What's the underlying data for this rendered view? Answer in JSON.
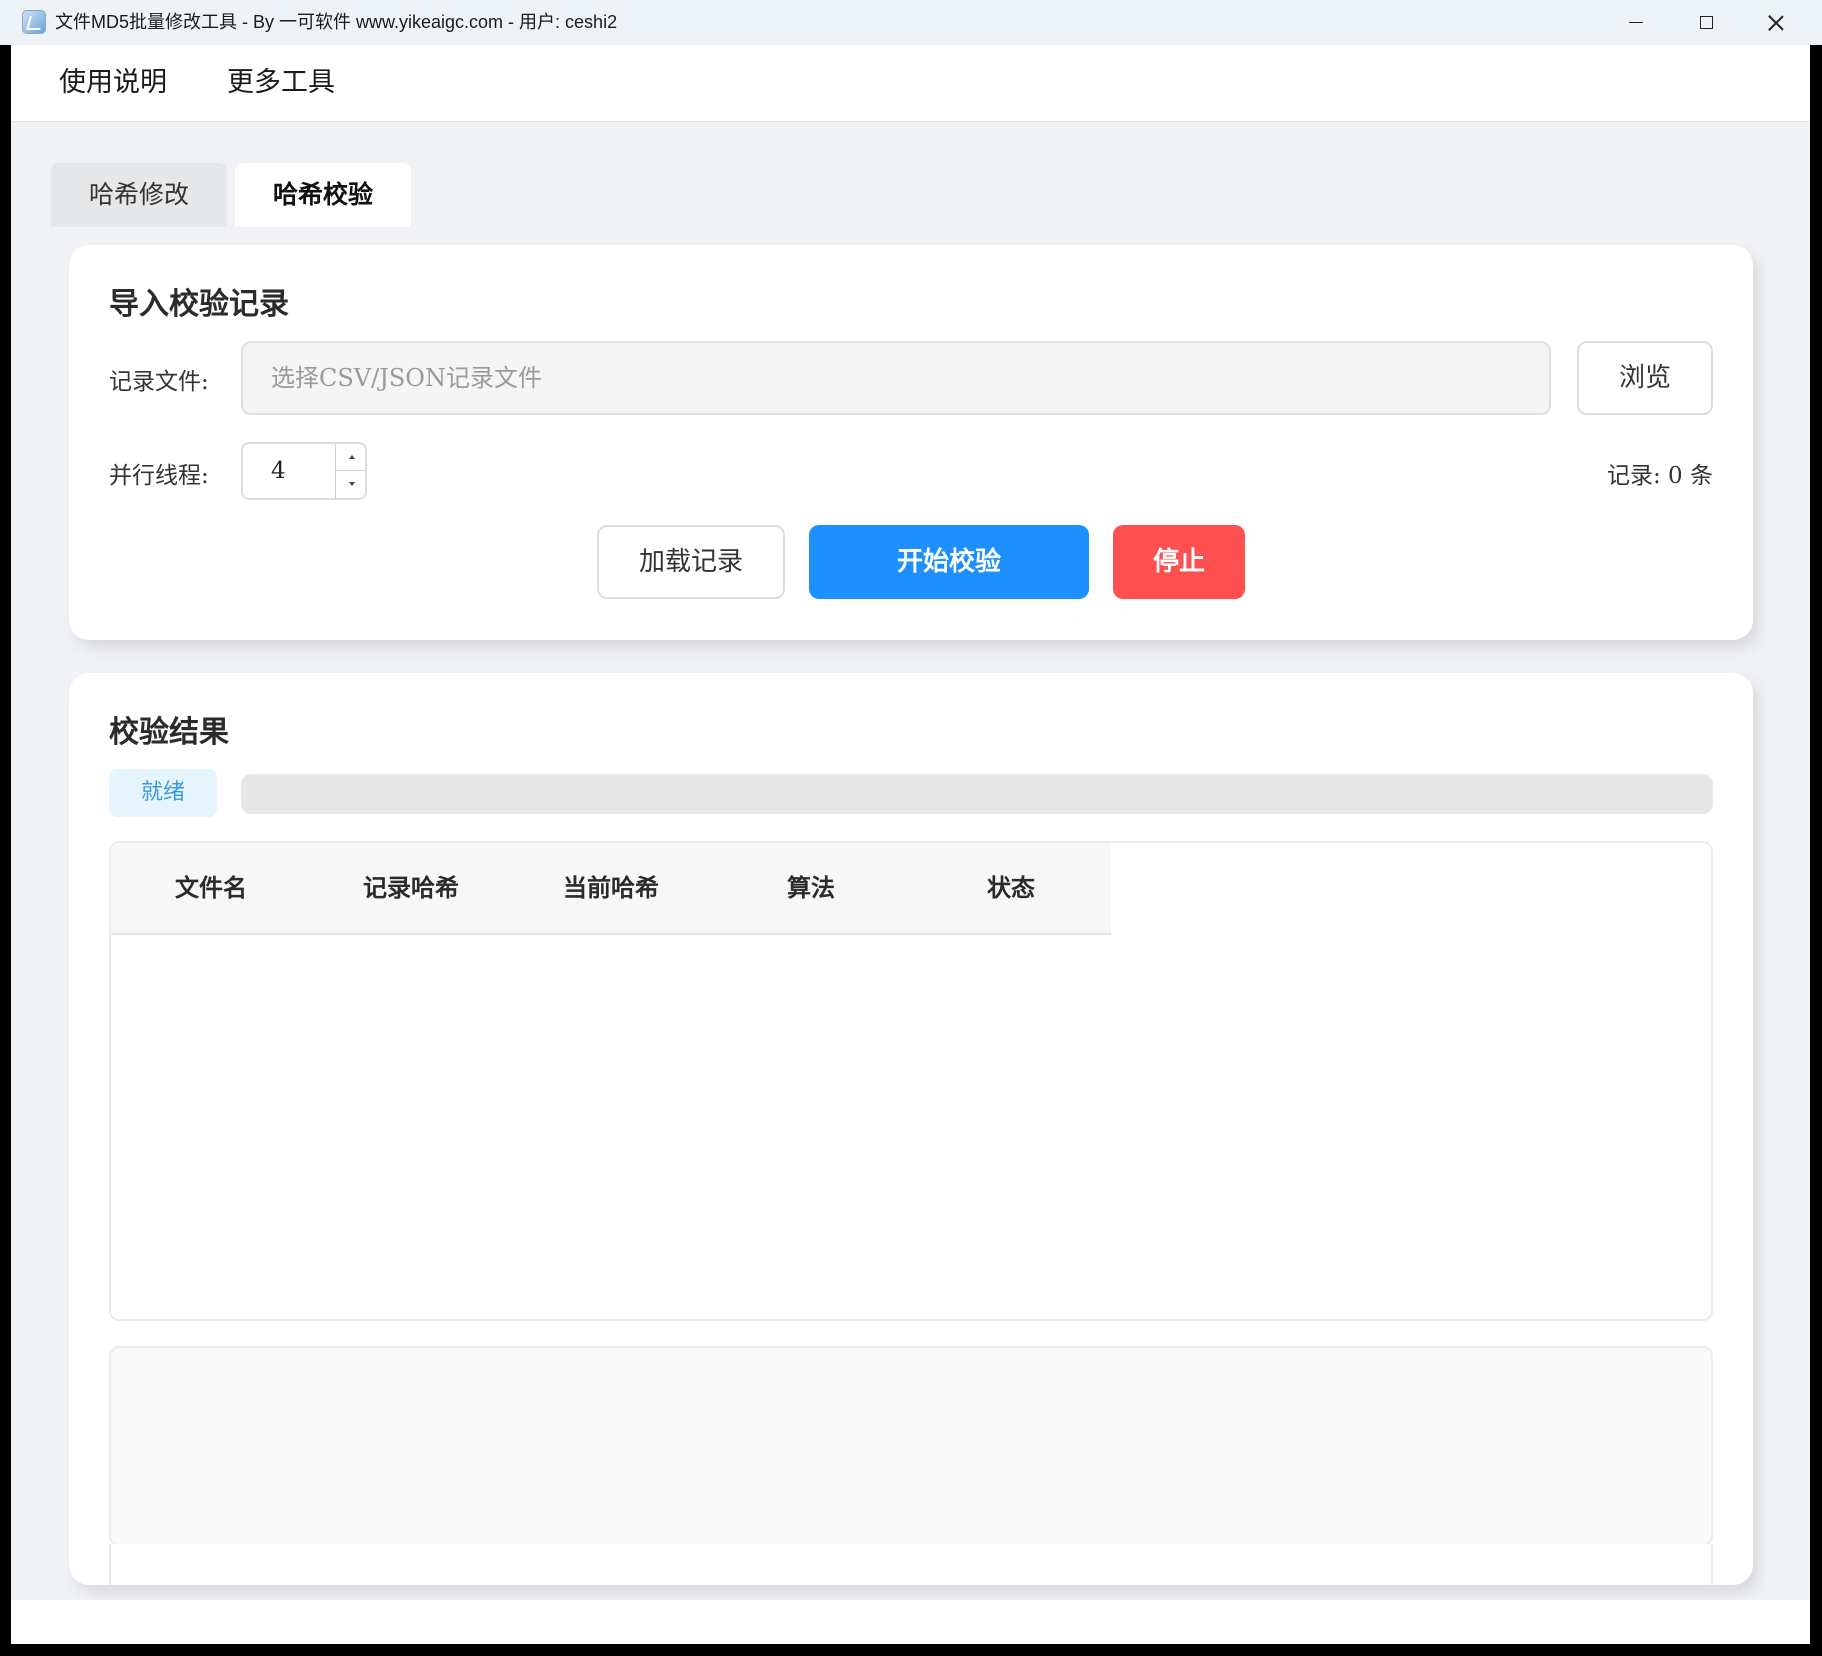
{
  "window": {
    "title": "文件MD5批量修改工具 - By 一可软件 www.yikeaigc.com - 用户: ceshi2",
    "app_icon": "app-icon"
  },
  "menubar": {
    "items": [
      "使用说明",
      "更多工具"
    ]
  },
  "tabs": [
    {
      "label": "哈希修改",
      "active": false
    },
    {
      "label": "哈希校验",
      "active": true
    }
  ],
  "import_section": {
    "title": "导入校验记录",
    "file_label": "记录文件:",
    "file_placeholder": "选择CSV/JSON记录文件",
    "file_value": "",
    "browse_label": "浏览",
    "threads_label": "并行线程:",
    "threads_value": "4",
    "record_count_text": "记录: 0 条",
    "load_label": "加载记录",
    "start_label": "开始校验",
    "stop_label": "停止"
  },
  "result_section": {
    "title": "校验结果",
    "status_text": "就绪",
    "progress_percent": 0,
    "columns": [
      "文件名",
      "记录哈希",
      "当前哈希",
      "算法",
      "状态"
    ],
    "rows": [],
    "log_text": ""
  },
  "colors": {
    "primary": "#1e8fff",
    "danger": "#fe4f51",
    "status_badge_bg": "#e6f4fd",
    "status_badge_text": "#3b9ad6",
    "page_bg": "#f0f2f5"
  }
}
